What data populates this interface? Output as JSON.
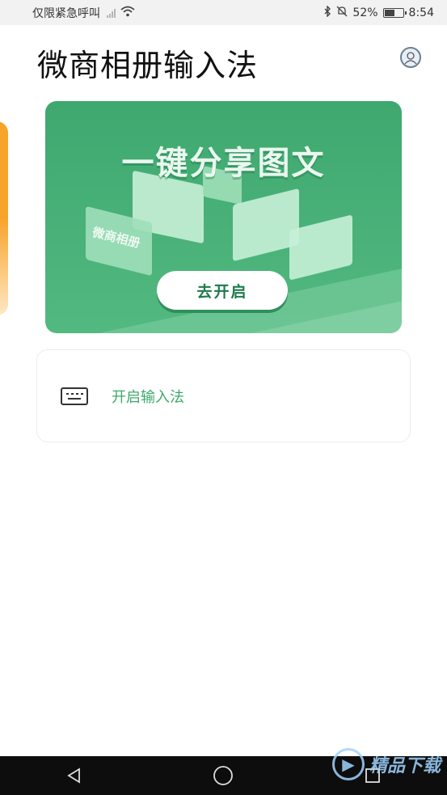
{
  "status_bar": {
    "carrier": "仅限紧急呼叫",
    "battery": "52%",
    "time": "8:54"
  },
  "header": {
    "title": "微商相册输入法"
  },
  "banner": {
    "title": "一键分享图文",
    "album_label": "微商相册",
    "button_label": "去开启"
  },
  "ime_row": {
    "label": "开启输入法",
    "icon": "keyboard-icon"
  },
  "watermark": {
    "text": "精品下载"
  },
  "colors": {
    "accent_green": "#3da86a",
    "banner_green": "#3ea86f",
    "peek_orange": "#f7a42b"
  },
  "icons": [
    "sim-icon",
    "wifi-icon",
    "bluetooth-icon",
    "mute-icon",
    "battery-icon",
    "avatar-icon",
    "back-icon",
    "home-icon",
    "recents-icon"
  ]
}
